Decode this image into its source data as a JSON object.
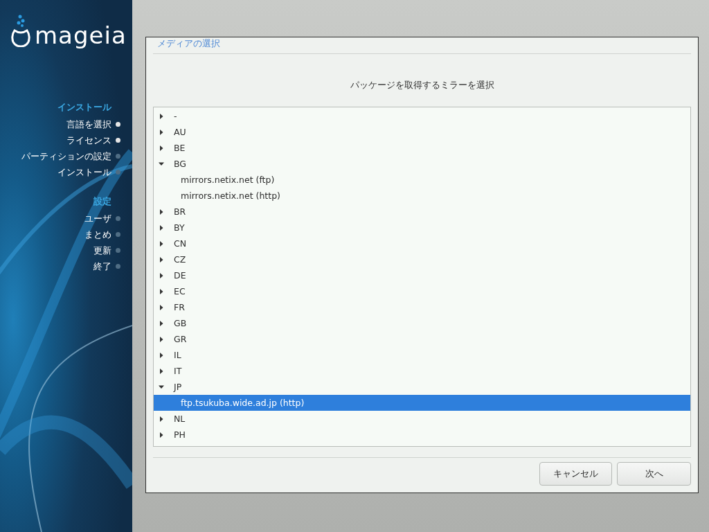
{
  "logo": {
    "text": "mageia"
  },
  "sidebar": {
    "sections": [
      {
        "title": "インストール",
        "steps": [
          {
            "label": "言語を選択",
            "done": true
          },
          {
            "label": "ライセンス",
            "done": true
          },
          {
            "label": "パーティションの設定",
            "done": false
          },
          {
            "label": "インストール",
            "done": false
          }
        ]
      },
      {
        "title": "設定",
        "steps": [
          {
            "label": "ユーザ",
            "done": false
          },
          {
            "label": "まとめ",
            "done": false
          },
          {
            "label": "更新",
            "done": false
          },
          {
            "label": "終了",
            "done": false
          }
        ]
      }
    ]
  },
  "dialog": {
    "title": "メディアの選択",
    "prompt": "パッケージを取得するミラーを選択",
    "tree": [
      {
        "label": "-",
        "expanded": false,
        "selected": false
      },
      {
        "label": "AU",
        "expanded": false,
        "selected": false
      },
      {
        "label": "BE",
        "expanded": false,
        "selected": false
      },
      {
        "label": "BG",
        "expanded": true,
        "selected": false,
        "children": [
          {
            "label": "mirrors.netix.net (ftp)",
            "selected": false
          },
          {
            "label": "mirrors.netix.net (http)",
            "selected": false
          }
        ]
      },
      {
        "label": "BR",
        "expanded": false,
        "selected": false
      },
      {
        "label": "BY",
        "expanded": false,
        "selected": false
      },
      {
        "label": "CN",
        "expanded": false,
        "selected": false
      },
      {
        "label": "CZ",
        "expanded": false,
        "selected": false
      },
      {
        "label": "DE",
        "expanded": false,
        "selected": false
      },
      {
        "label": "EC",
        "expanded": false,
        "selected": false
      },
      {
        "label": "FR",
        "expanded": false,
        "selected": false
      },
      {
        "label": "GB",
        "expanded": false,
        "selected": false
      },
      {
        "label": "GR",
        "expanded": false,
        "selected": false
      },
      {
        "label": "IL",
        "expanded": false,
        "selected": false
      },
      {
        "label": "IT",
        "expanded": false,
        "selected": false
      },
      {
        "label": "JP",
        "expanded": true,
        "selected": false,
        "children": [
          {
            "label": "ftp.tsukuba.wide.ad.jp (http)",
            "selected": true
          }
        ]
      },
      {
        "label": "NL",
        "expanded": false,
        "selected": false
      },
      {
        "label": "PH",
        "expanded": false,
        "selected": false
      }
    ],
    "buttons": [
      "キャンセル",
      "次へ"
    ]
  }
}
